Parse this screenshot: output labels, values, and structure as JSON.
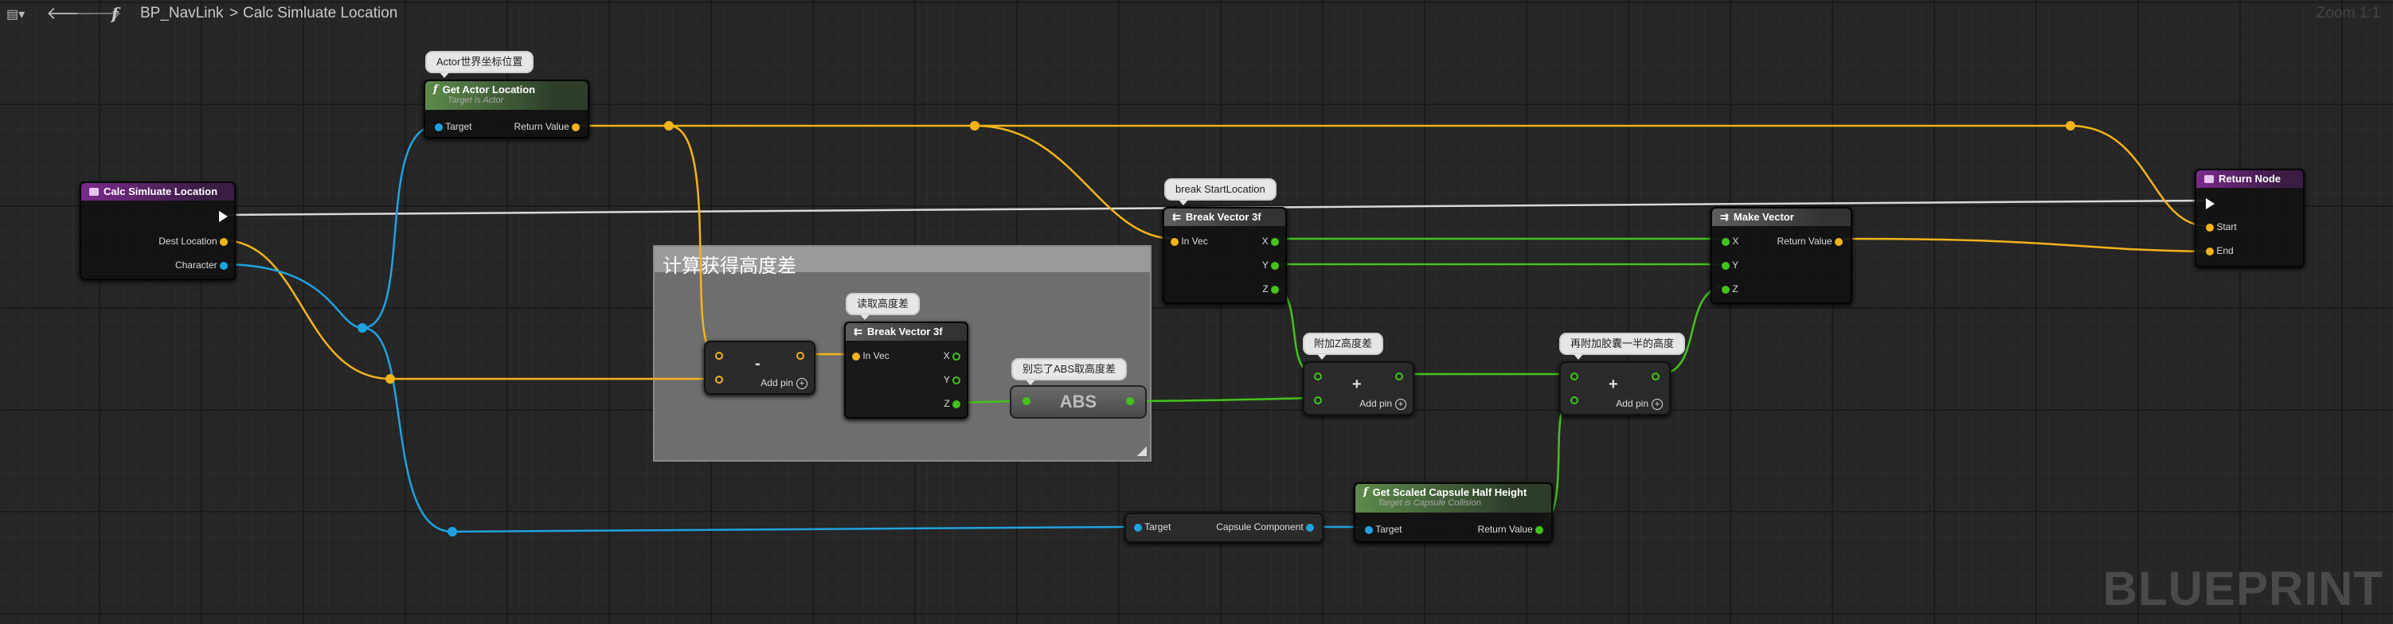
{
  "toolbar": {
    "breadcrumb_root": "BP_NavLink",
    "breadcrumb_sep": ">",
    "breadcrumb_current": "Calc Simluate Location",
    "function_glyph": "f",
    "zoom": "Zoom 1:1"
  },
  "watermark": "BLUEPRINT",
  "comment_group": {
    "title": "计算获得高度差"
  },
  "bubbles": {
    "actor_location": "Actor世界坐标位置",
    "read_height": "读取高度差",
    "abs_note": "别忘了ABS取高度差",
    "break_start": "break StartLocation",
    "add_z": "附加Z高度差",
    "add_half": "再附加胶囊一半的高度"
  },
  "nodes": {
    "entry": {
      "title": "Calc Simluate Location",
      "pins": {
        "dest_location": "Dest Location",
        "character": "Character"
      }
    },
    "get_actor_location": {
      "title": "Get Actor Location",
      "subtitle": "Target is Actor",
      "pins": {
        "target": "Target",
        "return_value": "Return Value"
      }
    },
    "subtract": {
      "op": "-",
      "add_pin": "Add pin"
    },
    "break_vector_inner": {
      "title": "Break Vector 3f",
      "pins": {
        "in_vec": "In Vec",
        "x": "X",
        "y": "Y",
        "z": "Z"
      }
    },
    "abs": {
      "label": "ABS"
    },
    "break_vector_start": {
      "title": "Break Vector 3f",
      "pins": {
        "in_vec": "In Vec",
        "x": "X",
        "y": "Y",
        "z": "Z"
      }
    },
    "add_z": {
      "op": "+",
      "add_pin": "Add pin"
    },
    "add_half": {
      "op": "+",
      "add_pin": "Add pin"
    },
    "make_vector": {
      "title": "Make Vector",
      "pins": {
        "x": "X",
        "y": "Y",
        "z": "Z",
        "return_value": "Return Value"
      }
    },
    "return_node": {
      "title": "Return Node",
      "pins": {
        "start": "Start",
        "end": "End"
      }
    },
    "capsule_component": {
      "pins": {
        "target": "Target",
        "capsule_component": "Capsule Component"
      }
    },
    "get_half_height": {
      "title": "Get Scaled Capsule Half Height",
      "subtitle": "Target is Capsule Collision",
      "pins": {
        "target": "Target",
        "return_value": "Return Value"
      }
    }
  },
  "colors": {
    "vector_pin": "#f2b41a",
    "float_pin": "#44c31d",
    "object_pin": "#1fa3e0",
    "exec_wire": "#e0e0e0",
    "function_header": "#5d8b4b",
    "entry_header": "#7a2a8c"
  }
}
